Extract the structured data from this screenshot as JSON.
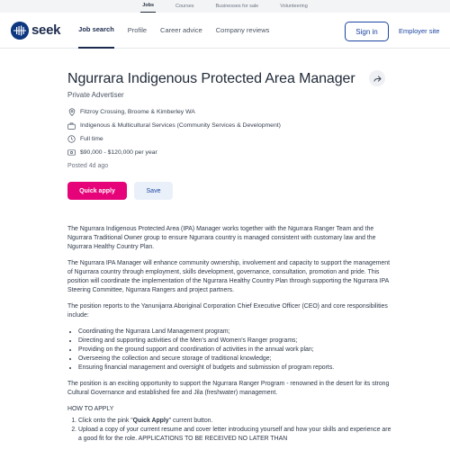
{
  "topbar": {
    "tabs": [
      "Jobs",
      "Courses",
      "Businesses for sale",
      "Volunteering"
    ]
  },
  "nav": {
    "logo_text": "seek",
    "links": [
      "Job search",
      "Profile",
      "Career advice",
      "Company reviews"
    ],
    "signin": "Sign in",
    "employer": "Employer site"
  },
  "job": {
    "title": "Ngurrara Indigenous Protected Area Manager",
    "advertiser": "Private Advertiser",
    "location": "Fitzroy Crossing, Broome & Kimberley WA",
    "classification": "Indigenous & Multicultural Services (Community Services & Development)",
    "work_type": "Full time",
    "salary": "$90,000 - $120,000 per year",
    "posted": "Posted 4d ago"
  },
  "actions": {
    "quick_apply": "Quick apply",
    "save": "Save"
  },
  "description": {
    "p1": "The Ngurrara Indigenous Protected Area (IPA) Manager works together with the Ngurrara Ranger Team and the Ngurrara Traditional Owner group to ensure Ngurrara country is managed consistent with customary law and the Ngurrara Healthy Country Plan.",
    "p2": "The Ngurrara IPA Manager will enhance community ownership, involvement and capacity to support the management of Ngurrara country through employment, skills development, governance, consultation, promotion and pride. This position will coordinate the implementation of the Ngurrara  Healthy Country Plan through supporting the Ngurrara IPA Steering Committee, Ngurrara Rangers and project partners.",
    "p3": "The position reports to the Yanunijarra Aboriginal Corporation Chief Executive Officer (CEO) and core responsibilities include:",
    "bullets": [
      "Coordinating the Ngurrara Land Management program;",
      "Directing and supporting activities of the Men's and Women's Ranger programs;",
      "Providing on the ground support and coordination of activities in the annual work plan;",
      "Overseeing the collection and secure storage of traditional knowledge;",
      "Ensuring financial management and oversight of budgets and submission of program reports."
    ],
    "p4": "The position is an exciting opportunity to support the Ngurrara Ranger Program - renowned in the desert for its strong Cultural Governance and established fire and Jila (freshwater) management.",
    "howto_heading": "HOW TO APPLY",
    "step1_pre": "Click onto the pink \"",
    "step1_bold": "Quick Apply",
    "step1_post": "\" current button.",
    "step2": "Upload a copy of your current resume and cover letter introducing yourself and how your skills and experience are a good fit for the role. APPLICATIONS TO BE RECEIVED NO LATER THAN"
  },
  "colors": {
    "brand": "#0d3880",
    "accent": "#e60278",
    "link": "#1c44a0"
  }
}
